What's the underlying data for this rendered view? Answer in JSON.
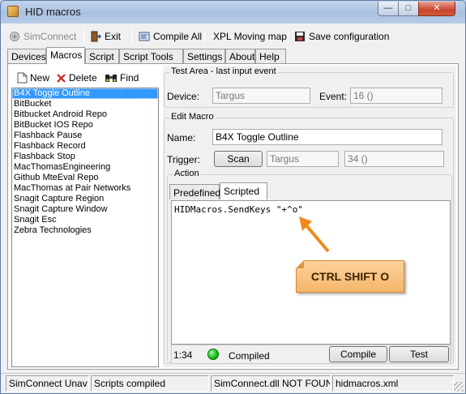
{
  "window": {
    "title": "HID macros"
  },
  "toolbar": {
    "simconnect": "SimConnect",
    "exit": "Exit",
    "compile_all": "Compile All",
    "xpl_moving_map": "XPL Moving map",
    "save_configuration": "Save configuration"
  },
  "tabs": [
    "Devices",
    "Macros",
    "Script",
    "Script Tools",
    "Settings",
    "About",
    "Help"
  ],
  "active_tab": "Macros",
  "macro_toolbar": {
    "new": "New",
    "delete": "Delete",
    "find": "Find"
  },
  "macros": [
    "B4X Toggle Outline",
    "BitBucket",
    "Bitbucket Android Repo",
    "BitBucket IOS Repo",
    "Flashback Pause",
    "Flashback Record",
    "Flashback Stop",
    "MacThomasEngineering",
    "Github MteEval Repo",
    "MacThomas at Pair Networks",
    "Snagit Capture Region",
    "Snagit Capture Window",
    "Snagit Esc",
    "Zebra Technologies"
  ],
  "selected_macro": "B4X Toggle Outline",
  "test_area": {
    "legend": "Test Area - last input event",
    "device_label": "Device:",
    "device_value": "Targus",
    "event_label": "Event:",
    "event_value": "16 ()"
  },
  "edit_macro": {
    "legend": "Edit Macro",
    "name_label": "Name:",
    "name_value": "B4X Toggle Outline",
    "trigger_label": "Trigger:",
    "scan_button": "Scan",
    "trigger_device": "Targus",
    "trigger_event": "34 ()"
  },
  "action": {
    "legend": "Action",
    "tabs": [
      "Predefined",
      "Scripted"
    ],
    "active_tab": "Scripted",
    "script": "HIDMacros.SendKeys \"+^o\"",
    "cursor_pos": "1:34",
    "compile_status": "Compiled",
    "compile_button": "Compile",
    "test_button": "Test",
    "status_color": "#14b814"
  },
  "annotation": {
    "text": "CTRL SHIFT O",
    "color": "#f5b66b",
    "arrow_color": "#f08a1c"
  },
  "statusbar": [
    "SimConnect Unav",
    "Scripts compiled",
    "SimConnect.dll NOT FOUN",
    "hidmacros.xml"
  ]
}
